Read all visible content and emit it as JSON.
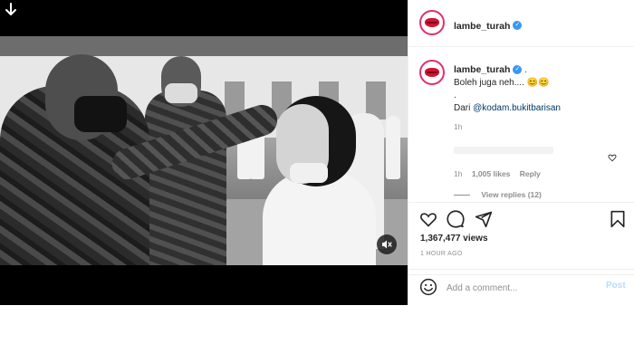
{
  "overlay": {
    "download_icon": "arrow-down-icon",
    "mute_icon": "speaker-muted-icon"
  },
  "post": {
    "username": "lambe_turah",
    "verified_icon": "verified-badge-icon",
    "caption": {
      "username": "lambe_turah",
      "suffix": " .",
      "line1": "Boleh juga neh....",
      "emoji1": "😊",
      "emoji2": "😊",
      "line2": ".",
      "from_label": "Dari ",
      "mention": "@kodam.bukitbarisan",
      "time": "1h"
    },
    "comment": {
      "time": "1h",
      "likes": "1,005 likes",
      "reply": "Reply",
      "view_replies": "View replies (12)"
    },
    "views": "1,367,477 views",
    "posted_ago": "1 HOUR AGO",
    "comment_placeholder": "Add a comment...",
    "post_button": "Post"
  },
  "colors": {
    "verified": "#3897f0",
    "mention": "#00376b",
    "post_button": "#b2dffc",
    "avatar_ring": "#e1306c"
  }
}
